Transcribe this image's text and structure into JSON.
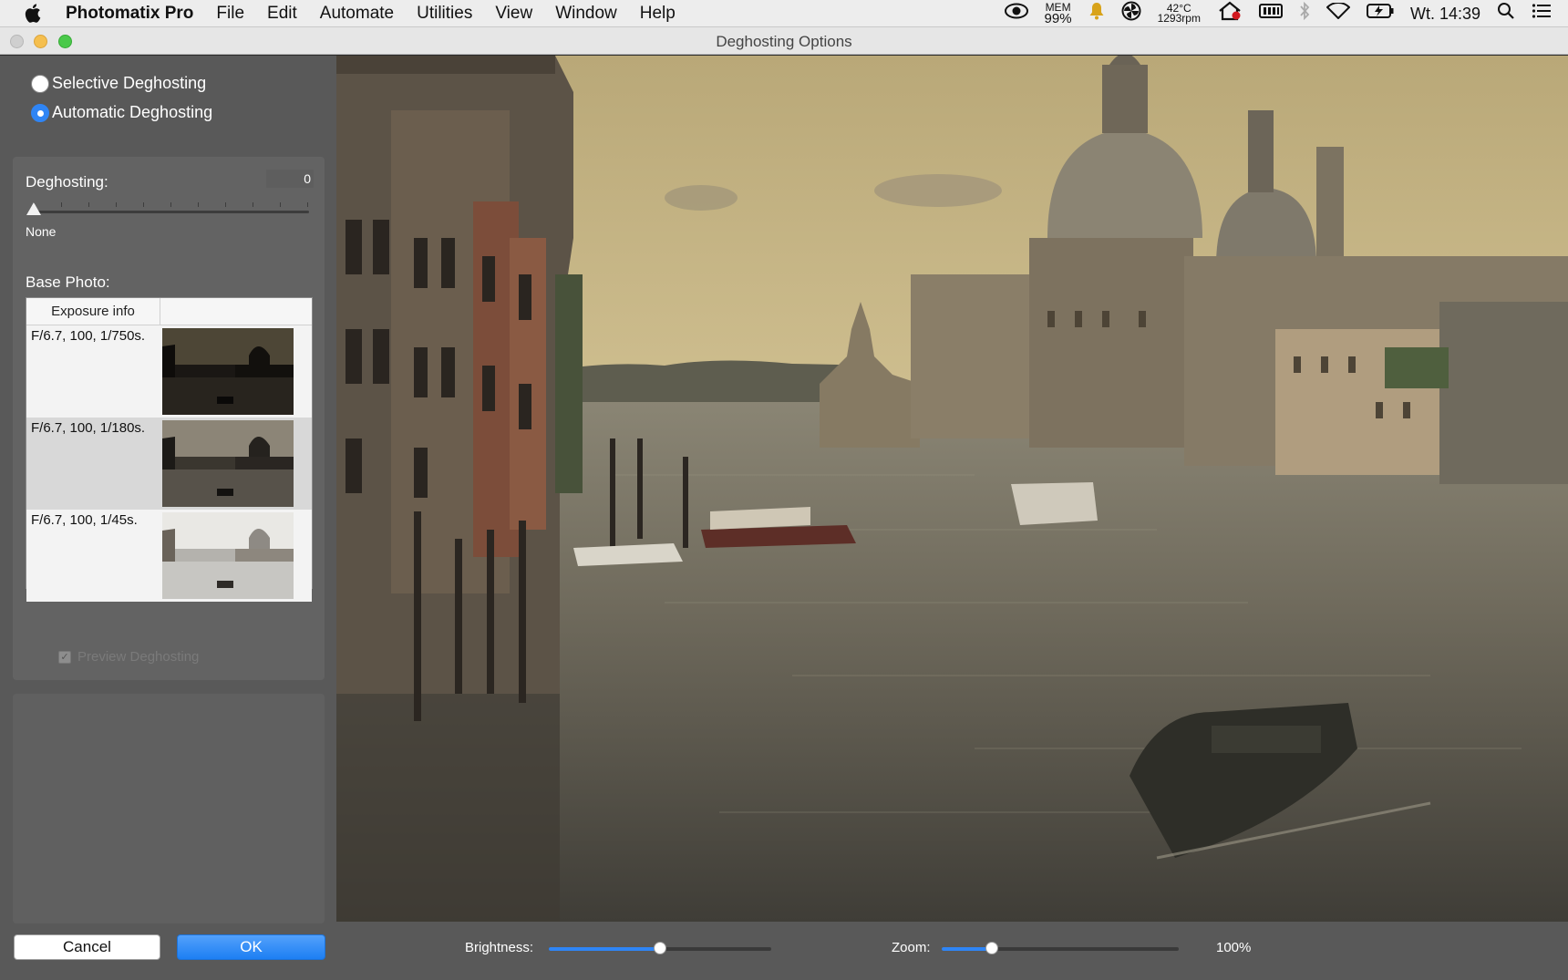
{
  "menubar": {
    "app_name": "Photomatix Pro",
    "items": [
      "File",
      "Edit",
      "Automate",
      "Utilities",
      "View",
      "Window",
      "Help"
    ],
    "status": {
      "mem_label": "MEM",
      "mem_value": "99%",
      "temp": "42°C",
      "fan": "1293rpm",
      "clock": "Wt. 14:39"
    }
  },
  "window": {
    "title": "Deghosting Options"
  },
  "options": {
    "selective_label": "Selective Deghosting",
    "automatic_label": "Automatic Deghosting",
    "selected": "automatic"
  },
  "deghosting": {
    "label": "Deghosting:",
    "value": "0",
    "level_name": "None",
    "level": 0
  },
  "base_photo": {
    "label": "Base Photo:",
    "column_header": "Exposure info",
    "rows": [
      {
        "info": "F/6.7, 100, 1/750s.",
        "selected": false,
        "tone": "dark"
      },
      {
        "info": "F/6.7, 100, 1/180s.",
        "selected": true,
        "tone": "mid"
      },
      {
        "info": "F/6.7, 100, 1/45s.",
        "selected": false,
        "tone": "bright"
      }
    ]
  },
  "preview": {
    "label": "Preview Deghosting",
    "checked": true,
    "enabled": false
  },
  "buttons": {
    "cancel": "Cancel",
    "ok": "OK"
  },
  "bottom": {
    "brightness_label": "Brightness:",
    "brightness_level": 0.5,
    "zoom_label": "Zoom:",
    "zoom_level": 0.21,
    "zoom_value": "100%"
  },
  "colors": {
    "accent": "#2f85f5",
    "panel": "#595959"
  }
}
